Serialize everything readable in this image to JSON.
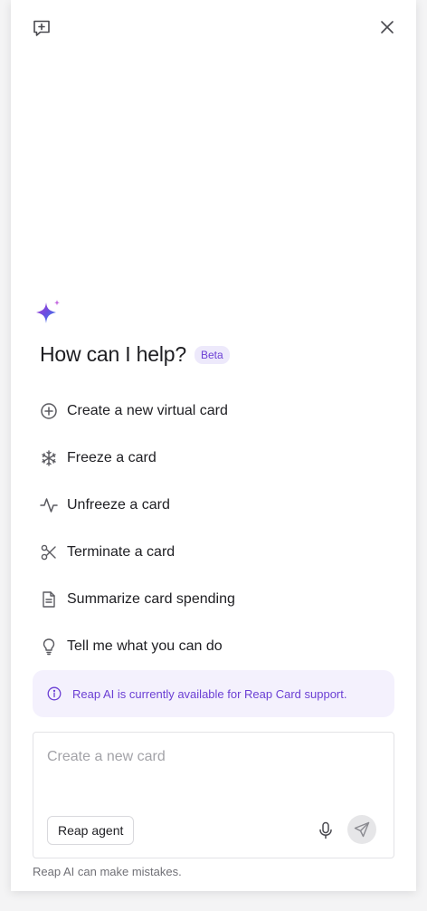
{
  "header": {
    "new_chat_icon": "message-plus-icon",
    "close_icon": "close-icon"
  },
  "hero": {
    "icon": "sparkle-icon",
    "title": "How can I help?",
    "badge": "Beta"
  },
  "suggestions": [
    {
      "icon": "plus-circle-icon",
      "label": "Create a new virtual card"
    },
    {
      "icon": "snowflake-icon",
      "label": "Freeze a card"
    },
    {
      "icon": "activity-icon",
      "label": "Unfreeze a card"
    },
    {
      "icon": "scissors-icon",
      "label": "Terminate a card"
    },
    {
      "icon": "document-icon",
      "label": "Summarize card spending"
    },
    {
      "icon": "lightbulb-icon",
      "label": "Tell me what you can do"
    }
  ],
  "info_banner": {
    "icon": "info-icon",
    "text": "Reap AI is currently available for Reap Card support."
  },
  "composer": {
    "placeholder": "Create a new card",
    "value": "",
    "agent_label": "Reap agent",
    "mic_icon": "microphone-icon",
    "send_icon": "send-icon"
  },
  "footer": {
    "disclaimer": "Reap AI can make mistakes."
  },
  "colors": {
    "accent": "#6b3fd4",
    "badge_bg": "#ede9fb",
    "banner_bg": "#f4f1fd",
    "icon_gray": "#5a5a60"
  }
}
